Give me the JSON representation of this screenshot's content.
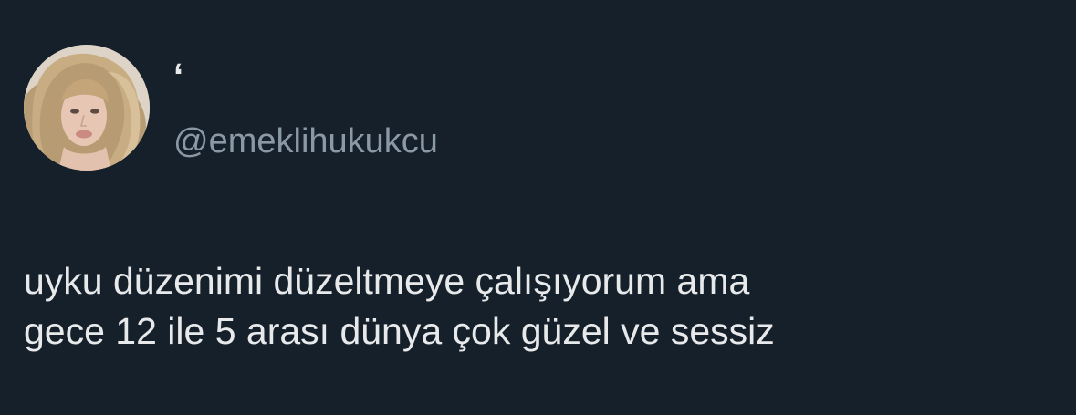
{
  "tweet": {
    "author": {
      "display_name": "‘",
      "handle": "@emeklihukukcu",
      "avatar": "profile-photo"
    },
    "text_lines": [
      "uyku düzenimi düzeltmeye çalışıyorum ama",
      "gece 12 ile 5 arası dünya çok güzel ve sessiz"
    ]
  },
  "colors": {
    "background": "#15202b",
    "text_primary": "#e7e9ea",
    "text_secondary": "#8b98a5"
  }
}
